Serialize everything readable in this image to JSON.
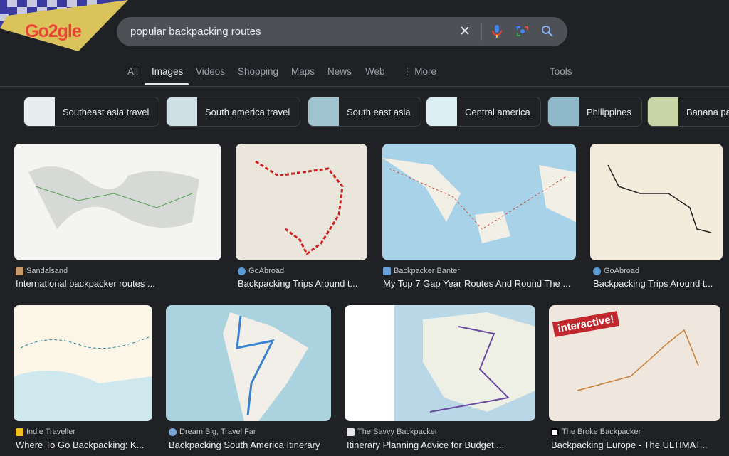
{
  "logo": {
    "text": "Go2gle"
  },
  "search": {
    "query": "popular backpacking routes"
  },
  "tabs": [
    {
      "label": "All"
    },
    {
      "label": "Images",
      "active": true
    },
    {
      "label": "Videos"
    },
    {
      "label": "Shopping"
    },
    {
      "label": "Maps"
    },
    {
      "label": "News"
    },
    {
      "label": "Web"
    },
    {
      "label": "More"
    }
  ],
  "tools_label": "Tools",
  "chips": [
    {
      "label": "Southeast asia travel"
    },
    {
      "label": "South america travel"
    },
    {
      "label": "South east asia"
    },
    {
      "label": "Central america"
    },
    {
      "label": "Philippines"
    },
    {
      "label": "Banana pa"
    }
  ],
  "results": [
    {
      "source": "Sandalsand",
      "title": "International backpacker routes ..."
    },
    {
      "source": "GoAbroad",
      "title": "Backpacking Trips Around t..."
    },
    {
      "source": "Backpacker Banter",
      "title": "My Top 7 Gap Year Routes And Round The ..."
    },
    {
      "source": "GoAbroad",
      "title": "Backpacking Trips Around t..."
    },
    {
      "source": "Indie Traveller",
      "title": "Where To Go Backpacking: K..."
    },
    {
      "source": "Dream Big, Travel Far",
      "title": "Backpacking South America Itinerary"
    },
    {
      "source": "The Savvy Backpacker",
      "title": "Itinerary Planning Advice for Budget ..."
    },
    {
      "source": "The Broke Backpacker",
      "title": "Backpacking Europe - The ULTIMAT..."
    }
  ],
  "image_text": {
    "interactive": "interactive!"
  },
  "colors": {
    "background": "#202124",
    "search_bg": "#4d5156",
    "text": "#e8eaed",
    "muted": "#9aa0a6"
  }
}
